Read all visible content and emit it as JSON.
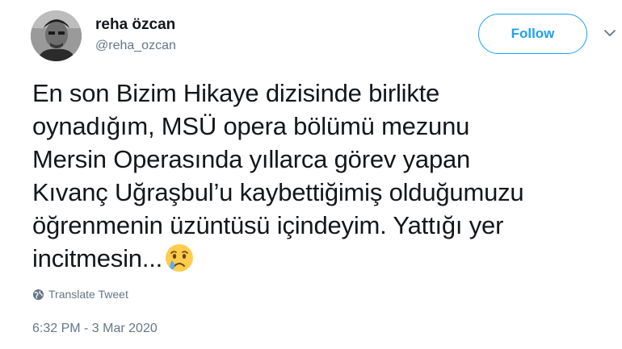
{
  "author": {
    "name": "reha özcan",
    "handle": "@reha_ozcan"
  },
  "follow_button": {
    "label": "Follow"
  },
  "menu": {
    "icon": "chevron-down-icon"
  },
  "tweet": {
    "lines": [
      "En son Bizim Hikaye dizisinde birlikte",
      "oynadığım, MSÜ opera bölümü mezunu",
      "Mersin Operasında yıllarca görev yapan",
      "Kıvanç Uğraşbul’u kaybettiğimiş olduğumuzu",
      "öğrenmenin üzüntüsü içindeyim. Yattığı yer",
      "incitmesin..."
    ],
    "emoji": "crying-face-emoji"
  },
  "translate": {
    "label": "Translate Tweet",
    "icon": "globe-icon"
  },
  "timestamp": "6:32 PM - 3 Mar 2020",
  "colors": {
    "accent": "#1da1f2",
    "text": "#14171a",
    "secondary": "#657786"
  }
}
